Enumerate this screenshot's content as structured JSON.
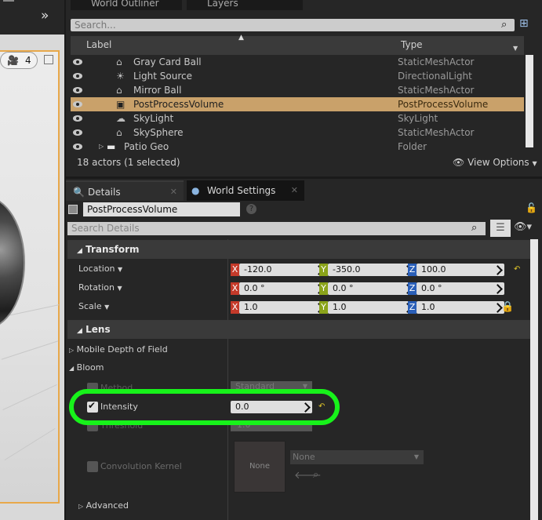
{
  "outliner": {
    "tab_world_outliner": "World Outliner",
    "tab_layers": "Layers",
    "search_placeholder": "Search...",
    "col_label": "Label",
    "col_type": "Type",
    "rows": [
      {
        "label": "Gray Card Ball",
        "type": "StaticMeshActor",
        "icon": "static-mesh-icon",
        "selected": false
      },
      {
        "label": "Light Source",
        "type": "DirectionalLight",
        "icon": "directional-light-icon",
        "selected": false
      },
      {
        "label": "Mirror Ball",
        "type": "StaticMeshActor",
        "icon": "static-mesh-icon",
        "selected": false
      },
      {
        "label": "PostProcessVolume",
        "type": "PostProcessVolume",
        "icon": "post-process-volume-icon",
        "selected": true
      },
      {
        "label": "SkyLight",
        "type": "SkyLight",
        "icon": "skylight-icon",
        "selected": false
      },
      {
        "label": "SkySphere",
        "type": "StaticMeshActor",
        "icon": "static-mesh-icon",
        "selected": false
      },
      {
        "label": "Patio Geo",
        "type": "Folder",
        "icon": "folder-icon",
        "selected": false
      }
    ],
    "status": "18 actors (1 selected)",
    "view_options": "View Options"
  },
  "viewport": {
    "camera_speed": "4"
  },
  "details": {
    "tab_details": "Details",
    "tab_world_settings": "World Settings",
    "object_name": "PostProcessVolume",
    "search_placeholder": "Search Details",
    "transform": {
      "title": "Transform",
      "location_label": "Location",
      "rotation_label": "Rotation",
      "scale_label": "Scale",
      "location": {
        "x": "-120.0",
        "y": "-350.0",
        "z": "100.0"
      },
      "rotation": {
        "x": "0.0 °",
        "y": "0.0 °",
        "z": "0.0 °"
      },
      "scale": {
        "x": "1.0",
        "y": "1.0",
        "z": "1.0"
      }
    },
    "lens": {
      "title": "Lens",
      "mobile_dof": "Mobile Depth of Field",
      "bloom": "Bloom",
      "method_label": "Method",
      "method_value": "Standard",
      "intensity_label": "Intensity",
      "intensity_value": "0.0",
      "threshold_label": "Threshold",
      "threshold_value": "1.0",
      "convolution_kernel_label": "Convolution Kernel",
      "kernel_thumb": "None",
      "kernel_dropdown": "None",
      "advanced": "Advanced"
    },
    "axis_labels": {
      "x": "X",
      "y": "Y",
      "z": "Z"
    }
  },
  "colors": {
    "selection": "#c9a16a",
    "highlight_ring": "#17f21a",
    "axis_x": "#c43a2a",
    "axis_y": "#8aa31a",
    "axis_z": "#2a5fb8"
  }
}
